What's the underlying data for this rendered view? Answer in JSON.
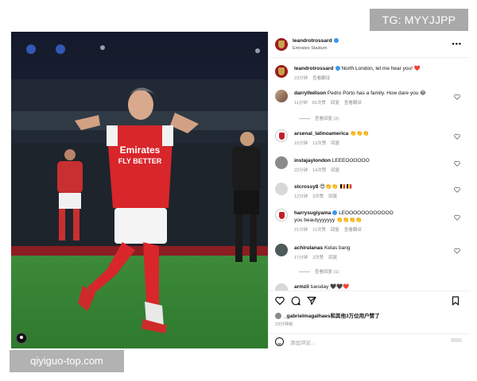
{
  "watermarks": {
    "top": "TG: MYYJJPP",
    "bottom": "qiyiguo-top.com"
  },
  "post": {
    "author": "leandrotrossard",
    "location": "Emirates Stadium",
    "more_icon": "more-horizontal-icon",
    "caption": {
      "user": "leandrotrossard",
      "text": "North London, let me hear you! ❤️",
      "time": "23分钟",
      "translate": "查看翻译"
    },
    "comments": [
      {
        "user": "darryllwilson",
        "text": "Pedro Porto has a family. How dare you 😂",
        "time": "11分钟",
        "likes": "81次赞",
        "reply": "回复",
        "translate": "查看翻译",
        "replies": "查看回复 (2)"
      },
      {
        "user": "arsenal_latinoamerica",
        "text": "👏👏👏",
        "time": "15分钟",
        "likes": "13次赞",
        "reply": "回复"
      },
      {
        "user": "instajaylondon",
        "text": "LEEEOOOOOO",
        "time": "22分钟",
        "likes": "14次赞",
        "reply": "回复"
      },
      {
        "user": "stcrossy8",
        "text": "😍👏👏 🇧🇪🇧🇪",
        "time": "12分钟",
        "likes": "3次赞",
        "reply": "回复"
      },
      {
        "user": "harrysugiyama",
        "text": "LEOOOOOOOOOOOO",
        "text2": "you beautyyyyyyy 👏👏👏👏",
        "time": "21分钟",
        "likes": "11次赞",
        "reply": "回复",
        "translate": "查看翻译"
      },
      {
        "user": "achirulanas",
        "text": "Kelas bang",
        "time": "17分钟",
        "likes": "3次赞",
        "reply": "回复",
        "replies": "查看回复 (1)"
      },
      {
        "user": "armzil",
        "text": "tuesday 🖤🖤❤️"
      }
    ],
    "liked_by": {
      "user": "_gabrielmagalhaes",
      "rest": "和其他3万位用户赞了"
    },
    "date": "23分钟前",
    "add_comment_placeholder": "添加评论..."
  }
}
